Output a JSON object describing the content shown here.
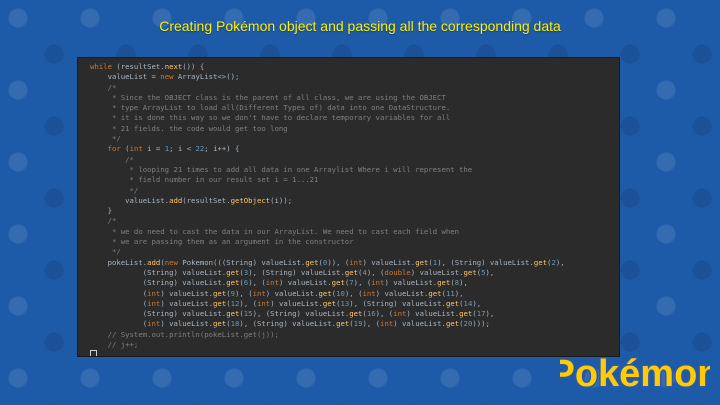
{
  "slide": {
    "title": "Creating Pokémon object and passing all the corresponding data"
  },
  "code": {
    "lines": [
      "while (resultSet.next()) {",
      "    valueList = new ArrayList<>();",
      "    /*",
      "     * Since the OBJECT class is the parent of all class, we are using the OBJECT",
      "     * type ArrayList to load all(Different Types of) data into one DataStructure.",
      "     * it is done this way so we don't have to declare temporary variables for all",
      "     * 21 fields. the code would get too long",
      "     */",
      "    for (int i = 1; i < 22; i++) {",
      "        /*",
      "         * looping 21 times to add all data in one Arraylist Where i will represent the",
      "         * field number in our result set i = 1...21",
      "         */",
      "        valueList.add(resultSet.getObject(i));",
      "    }",
      "    /*",
      "     * we do need to cast the data in our ArrayList. We need to cast each field when",
      "     * we are passing them as an argument in the constructor",
      "     */",
      "    pokeList.add(new Pokemon(((String) valueList.get(0)), (int) valueList.get(1), (String) valueList.get(2),",
      "            (String) valueList.get(3), (String) valueList.get(4), (double) valueList.get(5),",
      "            (String) valueList.get(6), (int) valueList.get(7), (int) valueList.get(8),",
      "            (int) valueList.get(9), (int) valueList.get(10), (int) valueList.get(11),",
      "            (int) valueList.get(12), (int) valueList.get(13), (String) valueList.get(14),",
      "            (String) valueList.get(15), (String) valueList.get(16), (int) valueList.get(17),",
      "            (int) valueList.get(18), (String) valueList.get(19), (int) valueList.get(20)));",
      "    // System.out.println(pokeList.get(j));",
      "    // j++;"
    ]
  },
  "logo": {
    "text": "Pokémon",
    "icon": "pokemon-logo-icon"
  },
  "colors": {
    "title": "#ffee00",
    "background": "#1d5aa8",
    "editor": "#2b2b2b"
  }
}
